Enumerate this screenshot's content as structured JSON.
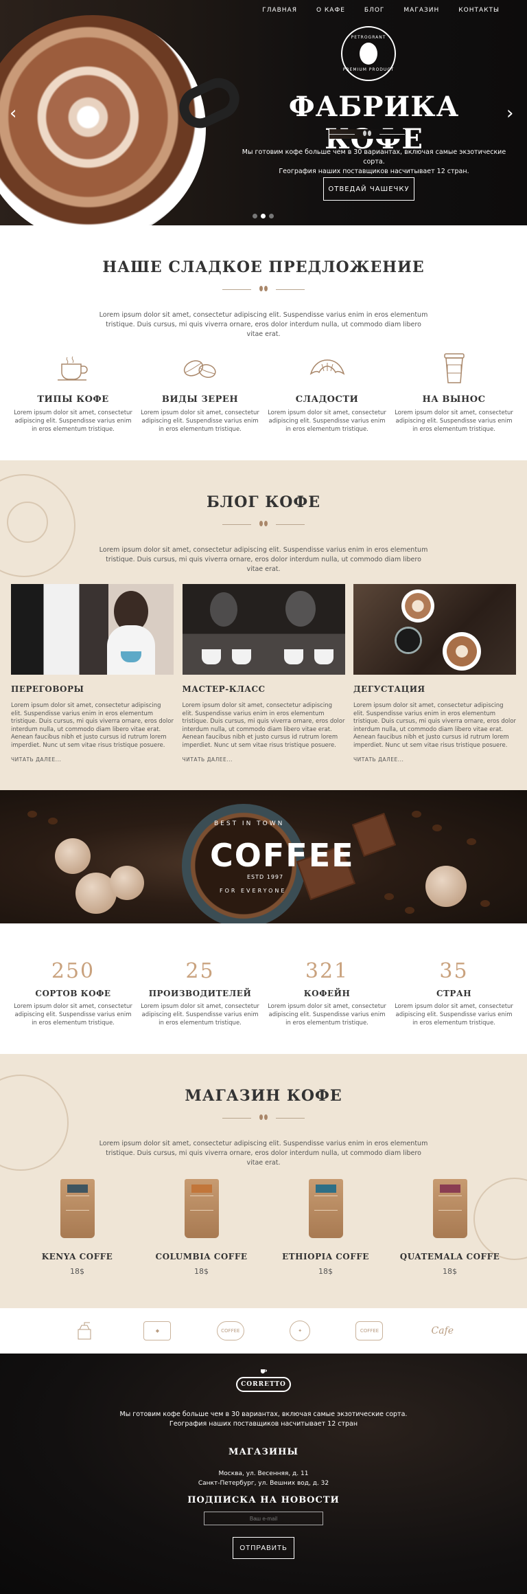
{
  "nav": [
    "ГЛАВНАЯ",
    "О КАФЕ",
    "БЛОГ",
    "МАГАЗИН",
    "КОНТАКТЫ"
  ],
  "hero": {
    "badge_top": "PETROGRANT",
    "badge_bottom": "PREMIUM PRODUCT",
    "title": "ФАБРИКА КОФЕ",
    "subtitle_1": "Мы готовим кофе больше чем в 30 вариантах, включая самые экзотические сорта.",
    "subtitle_2": "География наших поставщиков насчитывает 12 стран.",
    "button": "ОТВЕДАЙ ЧАШЕЧКУ"
  },
  "offer": {
    "title": "НАШЕ СЛАДКОЕ ПРЕДЛОЖЕНИЕ",
    "intro": "Lorem ipsum dolor sit amet, consectetur adipiscing elit. Suspendisse varius enim in eros elementum tristique. Duis cursus, mi quis viverra ornare, eros dolor interdum nulla, ut commodo diam libero vitae erat.",
    "items": [
      {
        "title": "ТИПЫ КОФЕ",
        "text": "Lorem ipsum dolor sit amet, consectetur adipiscing elit. Suspendisse varius enim in eros elementum tristique.",
        "icon": "coffee-cup-icon"
      },
      {
        "title": "ВИДЫ ЗЕРЕН",
        "text": "Lorem ipsum dolor sit amet, consectetur adipiscing elit. Suspendisse varius enim in eros elementum tristique.",
        "icon": "coffee-beans-icon"
      },
      {
        "title": "СЛАДОСТИ",
        "text": "Lorem ipsum dolor sit amet, consectetur adipiscing elit. Suspendisse varius enim in eros elementum tristique.",
        "icon": "croissant-icon"
      },
      {
        "title": "НА ВЫНОС",
        "text": "Lorem ipsum dolor sit amet, consectetur adipiscing elit. Suspendisse varius enim in eros elementum tristique.",
        "icon": "takeaway-cup-icon"
      }
    ]
  },
  "blog": {
    "title": "БЛОГ КОФЕ",
    "intro": "Lorem ipsum dolor sit amet, consectetur adipiscing elit. Suspendisse varius enim in eros elementum tristique. Duis cursus, mi quis viverra ornare, eros dolor interdum nulla, ut commodo diam libero vitae erat.",
    "posts": [
      {
        "title": "ПЕРЕГОВОРЫ",
        "text": "Lorem ipsum dolor sit amet, consectetur adipiscing elit. Suspendisse varius enim in eros elementum tristique. Duis cursus, mi quis viverra ornare, eros dolor interdum nulla, ut commodo diam libero vitae erat. Aenean faucibus nibh et justo cursus id rutrum lorem imperdiet. Nunc ut sem vitae risus tristique posuere.",
        "more": "ЧИТАТЬ ДАЛЕЕ..."
      },
      {
        "title": "МАСТЕР-КЛАСС",
        "text": "Lorem ipsum dolor sit amet, consectetur adipiscing elit. Suspendisse varius enim in eros elementum tristique. Duis cursus, mi quis viverra ornare, eros dolor interdum nulla, ut commodo diam libero vitae erat. Aenean faucibus nibh et justo cursus id rutrum lorem imperdiet. Nunc ut sem vitae risus tristique posuere.",
        "more": "ЧИТАТЬ ДАЛЕЕ..."
      },
      {
        "title": "ДЕГУСТАЦИЯ",
        "text": "Lorem ipsum dolor sit amet, consectetur adipiscing elit. Suspendisse varius enim in eros elementum tristique. Duis cursus, mi quis viverra ornare, eros dolor interdum nulla, ut commodo diam libero vitae erat. Aenean faucibus nibh et justo cursus id rutrum lorem imperdiet. Nunc ut sem vitae risus tristique posuere.",
        "more": "ЧИТАТЬ ДАЛЕЕ..."
      }
    ]
  },
  "banner": {
    "top": "BEST IN TOWN",
    "word": "COFFEE",
    "est": "ESTD 1997",
    "bottom": "FOR EVERYONE"
  },
  "stats": [
    {
      "num": "250",
      "title": "СОРТОВ КОФЕ",
      "text": "Lorem ipsum dolor sit amet, consectetur adipiscing elit. Suspendisse varius enim in eros elementum tristique."
    },
    {
      "num": "25",
      "title": "ПРОИЗВОДИТЕЛЕЙ",
      "text": "Lorem ipsum dolor sit amet, consectetur adipiscing elit. Suspendisse varius enim in eros elementum tristique."
    },
    {
      "num": "321",
      "title": "КОФЕЙН",
      "text": "Lorem ipsum dolor sit amet, consectetur adipiscing elit. Suspendisse varius enim in eros elementum tristique."
    },
    {
      "num": "35",
      "title": "СТРАН",
      "text": "Lorem ipsum dolor sit amet, consectetur adipiscing elit. Suspendisse varius enim in eros elementum tristique."
    }
  ],
  "shop": {
    "title": "МАГАЗИН КОФЕ",
    "intro": "Lorem ipsum dolor sit amet, consectetur adipiscing elit. Suspendisse varius enim in eros elementum tristique. Duis cursus, mi quis viverra ornare, eros dolor interdum nulla, ut commodo diam libero vitae erat.",
    "products": [
      {
        "name": "KENYA COFFE",
        "price": "18$",
        "label_color": "#3f5560"
      },
      {
        "name": "COLUMBIA COFFE",
        "price": "18$",
        "label_color": "#c2763a"
      },
      {
        "name": "ETHIOPIA COFFE",
        "price": "18$",
        "label_color": "#2f6f86"
      },
      {
        "name": "QUATEMALA COFFE",
        "price": "18$",
        "label_color": "#8a3d52"
      }
    ]
  },
  "logos": [
    "grinder-logo-icon",
    "badge-logo-icon",
    "COFFEE",
    "circle-logo-icon",
    "COFFEE",
    "Cafe"
  ],
  "footer": {
    "logo": "CORRETTO",
    "about_1": "Мы готовим кофе больше чем в 30 вариантах, включая самые экзотические сорта.",
    "about_2": "География наших поставщиков насчитывает 12 стран",
    "shops_title": "МАГАЗИНЫ",
    "address_1": "Москва, ул. Весенняя, д. 11",
    "address_2": "Санкт-Петербург, ул. Вешних вод, д. 32",
    "subscribe_title": "ПОДПИСКА НА НОВОСТИ",
    "email_placeholder": "Ваш e-mail",
    "send": "ОТПРАВИТЬ"
  },
  "colors": {
    "accent": "#c9a27e",
    "beige": "#efe5d6",
    "dark": "#121010"
  }
}
